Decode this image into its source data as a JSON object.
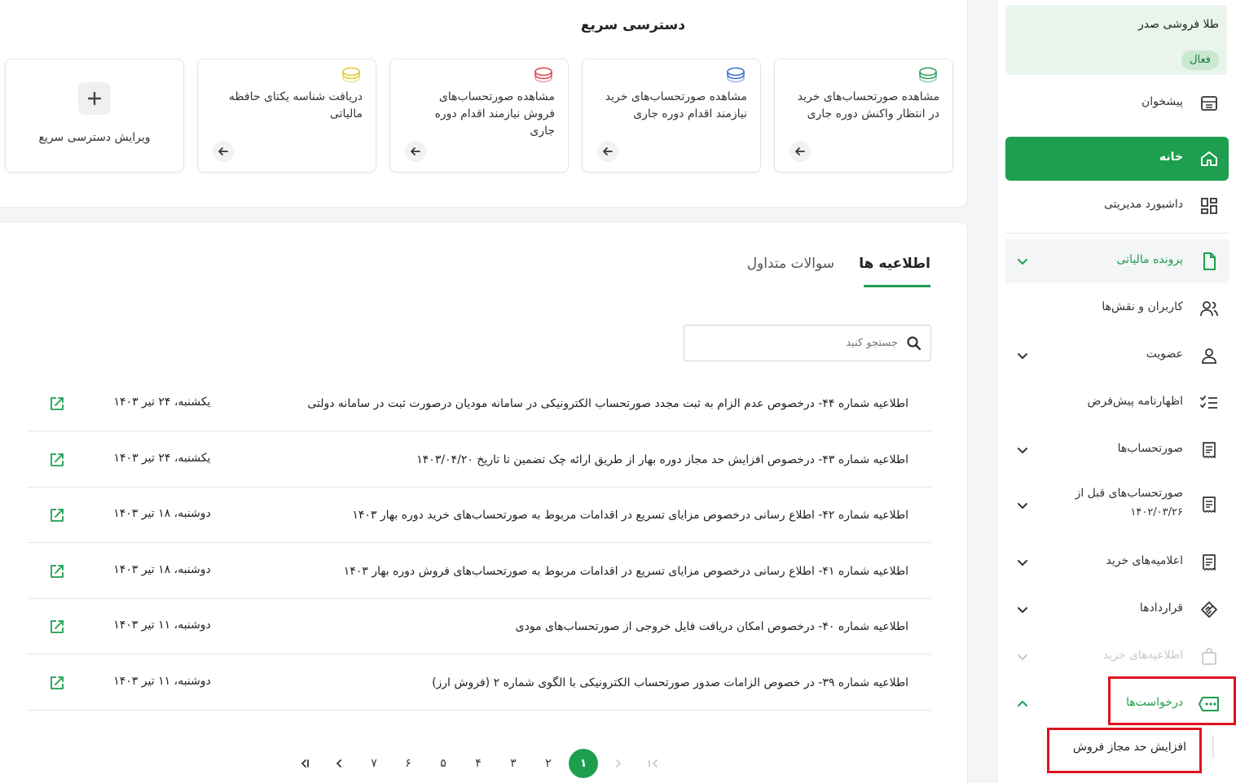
{
  "quick_access": {
    "title": "دسترسی سریع",
    "cards": [
      {
        "text": "مشاهده صورتحساب‌های خرید در انتظار واکنش دوره جاری",
        "icon": "coins-green-icon",
        "color": "#2e9e5b"
      },
      {
        "text": "مشاهده صورتحساب‌های خرید نیازمند اقدام دوره جاری",
        "icon": "coins-blue-icon",
        "color": "#3b6fd6"
      },
      {
        "text": "مشاهده صورتحساب‌های فروش نیازمند اقدام دوره جاری",
        "icon": "coins-red-icon",
        "color": "#e0434b"
      },
      {
        "text": "دریافت شناسه یکتای حافظه مالیاتی",
        "icon": "coins-yellow-icon",
        "color": "#e6c92a"
      }
    ],
    "edit_label": "ویرایش دسترسی سریع"
  },
  "announcements": {
    "tabs": {
      "active": "اطلاعیه ها",
      "inactive": "سوالات متداول"
    },
    "search_placeholder": "جستجو کنید",
    "rows": [
      {
        "title": "اطلاعیه شماره ۴۴- درخصوص عدم الزام به ثبت مجدد صورتحساب الکترونیکی در سامانه مودیان درصورت ثبت در سامانه دولتی",
        "date": "یکشنبه، ۲۴ تیر ۱۴۰۳"
      },
      {
        "title": "اطلاعیه شماره ۴۳- درخصوص افزایش حد مجاز دوره بهار از طریق ارائه چک تضمین تا تاریخ ۱۴۰۳/۰۴/۲۰",
        "date": "یکشنبه، ۲۴ تیر ۱۴۰۳"
      },
      {
        "title": "اطلاعیه شماره ۴۲- اطلاع رسانی درخصوص مزایای تسریع در اقدامات مربوط به صورتحساب‌های خرید دوره بهار ۱۴۰۳",
        "date": "دوشنبه، ۱۸ تیر ۱۴۰۳"
      },
      {
        "title": "اطلاعیه شماره ۴۱- اطلاع رسانی درخصوص مزایای تسریع در اقدامات مربوط به صورتحساب‌های فروش دوره بهار ۱۴۰۳",
        "date": "دوشنبه، ۱۸ تیر ۱۴۰۳"
      },
      {
        "title": "اطلاعیه شماره ۴۰- درخصوص امکان دریافت فایل خروجی از صورتحساب‌های مودی",
        "date": "دوشنبه، ۱۱ تیر ۱۴۰۳"
      },
      {
        "title": "اطلاعیه شماره ۳۹- در خصوص الزامات صدور صورتحساب الکترونیکی با الگوی شماره ۲ (فروش ارز)",
        "date": "دوشنبه، ۱۱ تیر ۱۴۰۳"
      }
    ],
    "pagination": {
      "pages": [
        "۱",
        "۲",
        "۳",
        "۴",
        "۵",
        "۶",
        "۷"
      ],
      "current": "۱"
    }
  },
  "sidebar": {
    "company": {
      "name": "طلا فروشی صدر",
      "status": "فعال"
    },
    "items": [
      {
        "label": "پیشخوان",
        "icon": "counter-icon"
      },
      {
        "label": "خانه",
        "icon": "home-icon"
      },
      {
        "label": "داشبورد مدیریتی",
        "icon": "dashboard-icon"
      },
      {
        "label": "پرونده مالیاتی",
        "icon": "file-icon"
      },
      {
        "label": "کاربران و نقش‌ها",
        "icon": "users-icon"
      },
      {
        "label": "عضویت",
        "icon": "user-icon"
      },
      {
        "label": "اظهارنامه پیش‌فرض",
        "icon": "checklist-icon"
      },
      {
        "label": "صورتحساب‌ها",
        "icon": "invoice-icon"
      },
      {
        "label": "صورتحساب‌های قبل از",
        "label2": "۱۴۰۲/۰۳/۲۶",
        "icon": "invoice-icon"
      },
      {
        "label": "اعلامیه‌های خرید",
        "icon": "invoice-icon"
      },
      {
        "label": "قراردادها",
        "icon": "handshake-icon"
      },
      {
        "label": "اطلاعیه‌های خرید",
        "icon": "bag-icon"
      },
      {
        "label": "درخواست‌ها",
        "icon": "message-dots-icon"
      }
    ],
    "subitem": "افزایش حد مجاز فروش"
  },
  "colors": {
    "accent": "#1e9e4f",
    "highlight": "#e0121f"
  }
}
